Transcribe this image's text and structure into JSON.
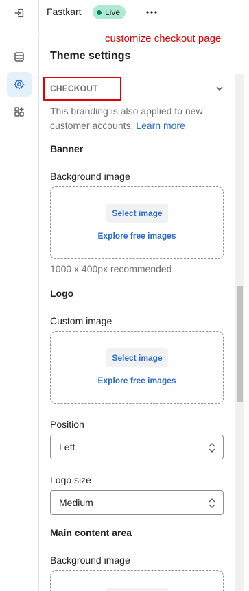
{
  "topbar": {
    "store_name": "Fastkart",
    "live_badge": "Live",
    "more_label": "•••"
  },
  "annotation": {
    "text": "customize checkout page",
    "color": "#e00000"
  },
  "panel": {
    "title": "Theme settings",
    "section_header": "CHECKOUT",
    "helptext": "This branding is also applied to new customer accounts.",
    "learn_more": "Learn more"
  },
  "banner": {
    "heading": "Banner",
    "bg_label": "Background image",
    "select_image": "Select image",
    "explore": "Explore free images",
    "hint": "1000 x 400px recommended"
  },
  "logo": {
    "heading": "Logo",
    "custom_label": "Custom image",
    "select_image": "Select image",
    "explore": "Explore free images",
    "position_label": "Position",
    "position_value": "Left",
    "size_label": "Logo size",
    "size_value": "Medium"
  },
  "main_content": {
    "heading": "Main content area",
    "bg_label": "Background image"
  },
  "colors": {
    "accent": "#2c6ecb",
    "live_badge_bg": "#aee9d1",
    "rail_active_bg": "#e4f0fa"
  }
}
